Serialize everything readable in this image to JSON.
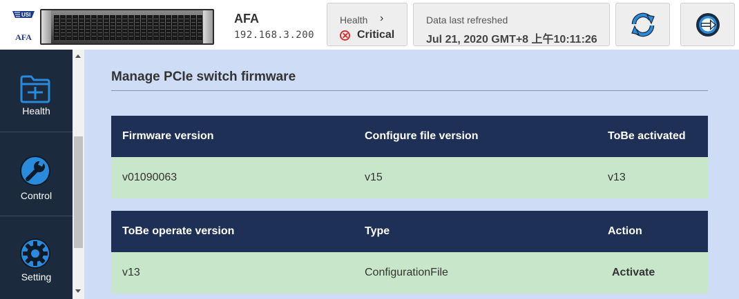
{
  "header": {
    "logo_badge": "USI",
    "logo_text": "AFA",
    "system_name": "AFA",
    "ip_address": "192.168.3.200",
    "health": {
      "label": "Health",
      "chevron": "›",
      "status": "Critical",
      "status_color": "#d32f2f",
      "icon": "critical-x-circle-icon"
    },
    "refresh": {
      "label": "Data last refreshed",
      "value": "Jul 21, 2020 GMT+8 上午10:11:26"
    },
    "buttons": [
      {
        "name": "refresh",
        "icon": "refresh-icon"
      },
      {
        "name": "logout",
        "icon": "logout-icon"
      }
    ]
  },
  "sidebar": {
    "items": [
      {
        "label": "Health",
        "icon": "folder-icon"
      },
      {
        "label": "Control",
        "icon": "wrench-icon"
      },
      {
        "label": "Setting",
        "icon": "gear-icon"
      }
    ]
  },
  "main": {
    "title": "Manage PCIe switch firmware",
    "table1": {
      "headers": [
        "Firmware version",
        "Configure file version",
        "ToBe activated"
      ],
      "row": [
        "v01090063",
        "v15",
        "v13"
      ]
    },
    "table2": {
      "headers": [
        "ToBe operate version",
        "Type",
        "Action"
      ],
      "row": [
        "v13",
        "ConfigurationFile",
        "Activate"
      ]
    }
  },
  "colors": {
    "sidebar_bg": "#1c2a3d",
    "main_bg": "#cfdcf5",
    "table_header_bg": "#1e3056",
    "table_row_bg": "#c8e6c9",
    "accent_blue": "#2a6ad8"
  }
}
